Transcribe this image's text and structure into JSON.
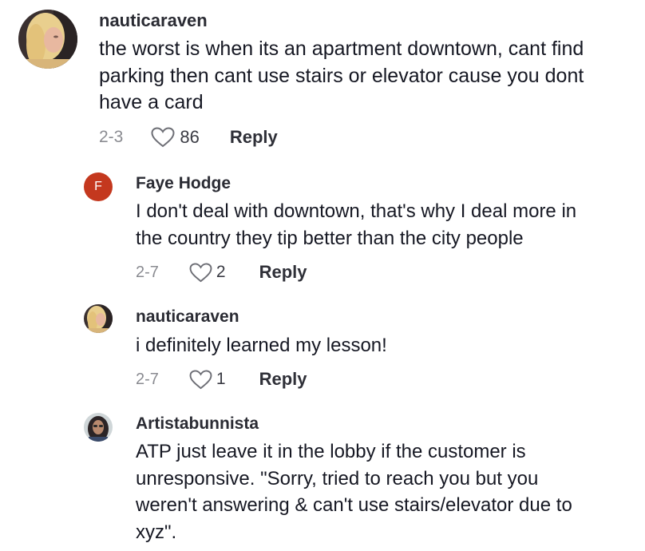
{
  "comments": [
    {
      "username": "nauticaraven",
      "text": "the worst is when its an apartment downtown, cant find\nparking then cant use stairs or elevator cause you dont\nhave a card",
      "date": "2-3",
      "likes": "86",
      "reply_label": "Reply",
      "avatar_icon": "photo-avatar",
      "heart_icon": "heart-outline-icon"
    },
    {
      "username": "Faye Hodge",
      "text": "I don't deal with downtown, that's why I deal more in\nthe country they tip better than the city people",
      "date": "2-7",
      "likes": "2",
      "reply_label": "Reply",
      "avatar_letter": "F",
      "avatar_color": "#c4381e",
      "heart_icon": "heart-outline-icon"
    },
    {
      "username": "nauticaraven",
      "text": "i definitely learned my lesson!",
      "date": "2-7",
      "likes": "1",
      "reply_label": "Reply",
      "avatar_icon": "photo-avatar",
      "heart_icon": "heart-outline-icon"
    },
    {
      "username": "Artistabunnista",
      "text": "ATP just leave it in the lobby if the customer is\nunresponsive. \"Sorry, tried to reach you but you\nweren't answering & can't use stairs/elevator due to\nxyz\".",
      "avatar_icon": "photo-avatar"
    }
  ],
  "colors": {
    "text": "#161823",
    "muted": "#8a8b91",
    "username": "#2a2b33",
    "letter_avatar_bg": "#c4381e"
  }
}
